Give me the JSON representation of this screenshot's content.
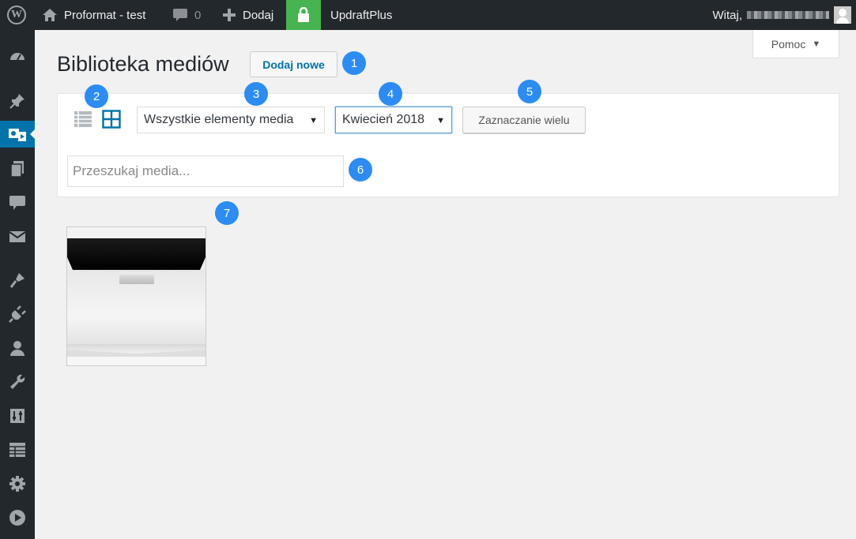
{
  "adminbar": {
    "site_name": "Proformat - test",
    "comments_count": "0",
    "new_label": "Dodaj",
    "updraft_label": "UpdraftPlus",
    "howdy": "Witaj,"
  },
  "help": {
    "label": "Pomoc"
  },
  "page": {
    "title": "Biblioteka mediów",
    "add_new": "Dodaj nowe"
  },
  "toolbar": {
    "type_filter": "Wszystkie elementy media",
    "date_filter": "Kwiecień 2018",
    "bulk_select": "Zaznaczanie wielu",
    "search_placeholder": "Przeszukaj media..."
  },
  "badges": [
    "1",
    "2",
    "3",
    "4",
    "5",
    "6",
    "7"
  ],
  "colors": {
    "adminbar_bg": "#23282d",
    "accent": "#0073aa",
    "lock_green": "#46b450",
    "badge_blue": "#2c8cf4"
  },
  "sidebar_icons": [
    "dashboard-icon",
    "pin-icon",
    "media-icon",
    "pages-icon",
    "comments-icon",
    "mail-icon",
    "appearance-icon",
    "plugins-icon",
    "users-icon",
    "tools-icon",
    "settings-sliders-icon",
    "table-icon",
    "gear-icon",
    "play-icon"
  ]
}
